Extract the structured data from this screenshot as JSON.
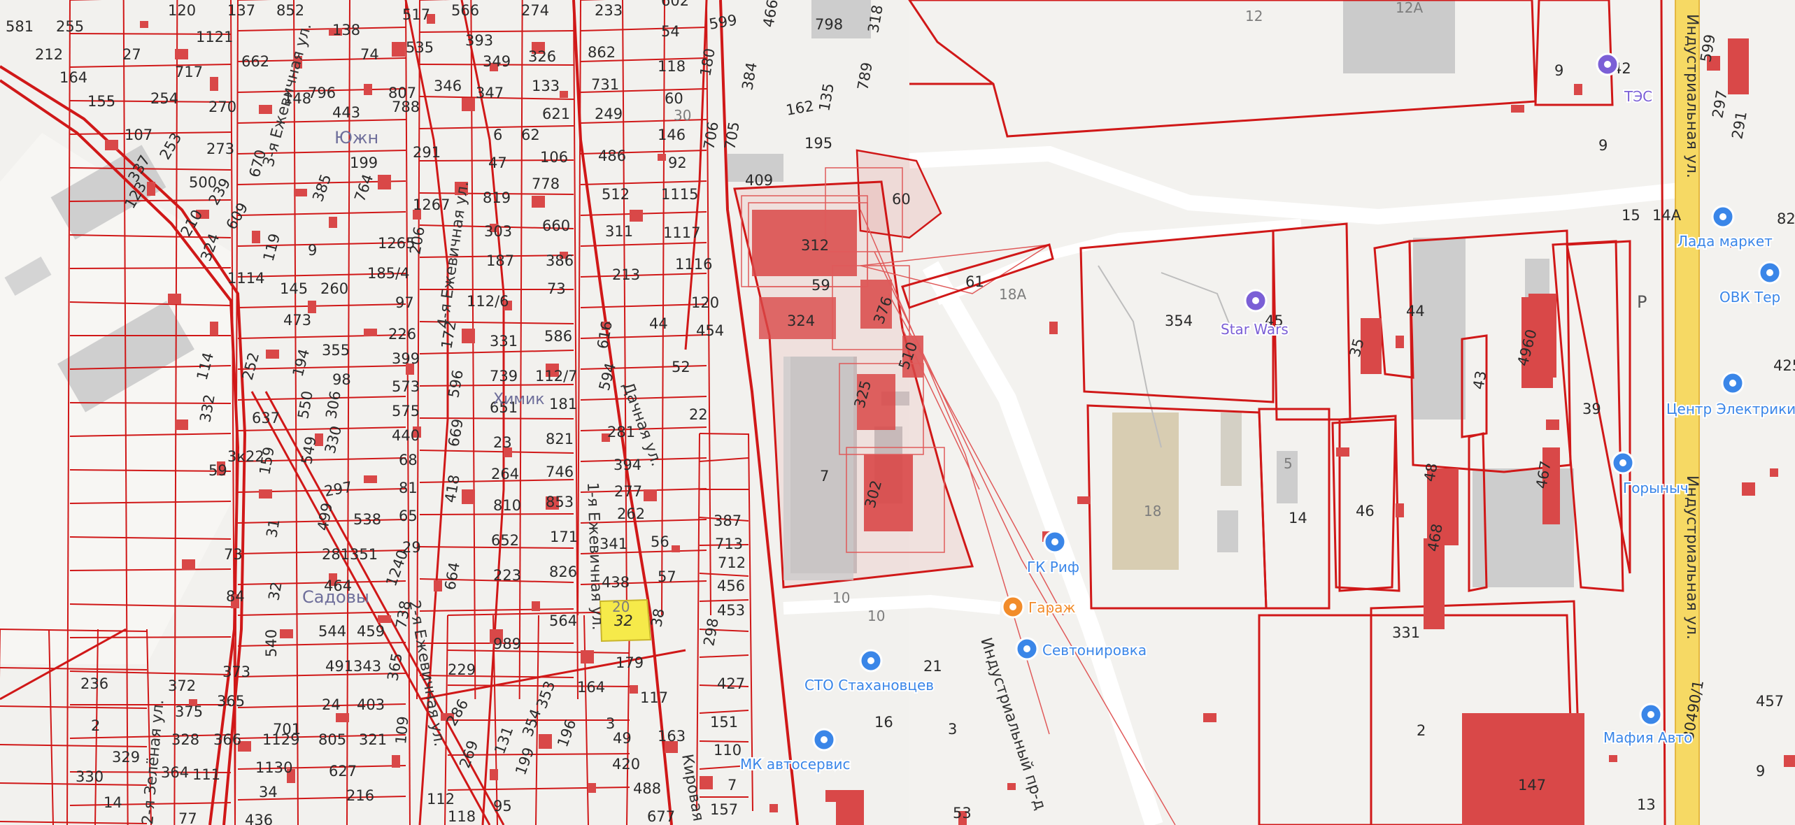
{
  "colors": {
    "background": "#f2f1ee",
    "parcel_line": "#d01818",
    "building_fill": "#d94848",
    "selected_parcel": "#f6ea4a",
    "poi_blue": "#3a86e8",
    "poi_orange": "#f28c2a",
    "poi_purple": "#7b5fd6",
    "highway_yellow": "#f6d964"
  },
  "streets": [
    {
      "id": "industrialnaya-1",
      "text": "Индустриальная ул."
    },
    {
      "id": "industrialnaya-2",
      "text": "Индустриальная ул."
    },
    {
      "id": "industrialny-pr",
      "text": "Индустриальный пр-д"
    },
    {
      "id": "ezhevichnaya-3",
      "text": "3-я Ежевичная ул."
    },
    {
      "id": "ezhevichnaya-4",
      "text": "4-я Ежевичная ул."
    },
    {
      "id": "ezhevichnaya-1",
      "text": "1-я Ежевичная ул."
    },
    {
      "id": "ezhevichnaya-2",
      "text": "2-я Ежевичная ул."
    },
    {
      "id": "dachnaya",
      "text": "Дачная ул."
    },
    {
      "id": "zelenaya",
      "text": "2-я Зелёная ул."
    },
    {
      "id": "kirova",
      "text": "Кировая ул."
    }
  ],
  "areas": [
    {
      "id": "yuzhny",
      "text": "Южн"
    },
    {
      "id": "khimik",
      "text": "Химик"
    },
    {
      "id": "sadovy",
      "text": "Садовы"
    }
  ],
  "pois": [
    {
      "id": "tes",
      "text": "ТЭС",
      "icon": "power-plant-icon",
      "color": "#7b5fd6"
    },
    {
      "id": "star-wars",
      "text": "Star Wars",
      "icon": "trophy-icon",
      "color": "#7b5fd6"
    },
    {
      "id": "lada-market",
      "text": "Лада маркет",
      "icon": "car-icon",
      "color": "#3a86e8"
    },
    {
      "id": "ovk",
      "text": "ОВК Тер",
      "icon": "shopping-bag-icon",
      "color": "#3a86e8"
    },
    {
      "id": "center-electric",
      "text": "Центр Электрики",
      "icon": "shopping-bag-icon",
      "color": "#3a86e8"
    },
    {
      "id": "gorynych",
      "text": "Горыныч",
      "icon": "shopping-bag-icon",
      "color": "#3a86e8"
    },
    {
      "id": "gk-rif",
      "text": "ГК Риф",
      "icon": "car-icon",
      "color": "#3a86e8"
    },
    {
      "id": "garazh",
      "text": "Гараж",
      "icon": "cafe-icon",
      "color": "#f28c2a"
    },
    {
      "id": "sevtonirovka",
      "text": "Севтонировка",
      "icon": "car-icon",
      "color": "#3a86e8"
    },
    {
      "id": "sto-stakhanovtsev",
      "text": "СТО Стахановцев",
      "icon": "car-icon",
      "color": "#3a86e8"
    },
    {
      "id": "mk-avtoservis",
      "text": "МК автосервис",
      "icon": "wrench-icon",
      "color": "#3a86e8"
    },
    {
      "id": "mafia-avto",
      "text": "Мафия Авто",
      "icon": "car-icon",
      "color": "#3a86e8"
    },
    {
      "id": "parking",
      "text": "P",
      "icon": "parking-icon",
      "color": "#555555"
    }
  ],
  "parcels": {
    "n581": "581",
    "n212": "212",
    "n255": "255",
    "n120": "120",
    "n137": "137",
    "n852": "852",
    "n517": "517",
    "n566": "566",
    "n274": "274",
    "n233": "233",
    "n602": "602",
    "n466": "466",
    "n798": "798",
    "n318": "318",
    "n27": "27",
    "n164": "164",
    "n155": "155",
    "n717": "717",
    "n1121": "1121",
    "n662": "662",
    "n138": "138",
    "n74": "74",
    "n535": "535",
    "n393": "393",
    "n349": "349",
    "n326": "326",
    "n862": "862",
    "n54": "54",
    "n599": "599",
    "n107": "107",
    "n254": "254",
    "n270": "270",
    "n443": "443",
    "n788": "788",
    "n807": "807",
    "n346": "346",
    "n347": "347",
    "n133": "133",
    "n731": "731",
    "n118": "118",
    "n180": "180",
    "n384": "384",
    "n162": "162",
    "n135": "135",
    "n789": "789",
    "n148": "148",
    "n796": "796",
    "n273": "273",
    "n199": "199",
    "n291": "291",
    "n6": "6",
    "n62": "62",
    "n621": "621",
    "n249": "249",
    "n60": "60",
    "n30": "30",
    "n146": "146",
    "n706": "706",
    "n705": "705",
    "n195": "195",
    "n337": "337",
    "n253": "253",
    "n500": "500",
    "n670": "670",
    "n385": "385",
    "n47": "47",
    "n106": "106",
    "n486": "486",
    "n92": "92",
    "n409": "409",
    "n123": "123",
    "n239": "239",
    "n764": "764",
    "n1267": "1267",
    "n819": "819",
    "n778": "778",
    "n512": "512",
    "n1115": "1115",
    "n210": "210",
    "n609": "609",
    "n303": "303",
    "n660": "660",
    "n311": "311",
    "n1117": "1117",
    "n324a": "324",
    "n119": "119",
    "n9": "9",
    "n1265": "1265",
    "n206": "206",
    "n187": "187",
    "n386": "386",
    "n213": "213",
    "n1116": "1116",
    "n1114": "1114",
    "n145": "145",
    "n260": "260",
    "n1854": "185/4",
    "n97": "97",
    "n1126": "112/6",
    "n73": "73",
    "n120b": "120",
    "n454": "454",
    "n473": "473",
    "n53": "53",
    "n226": "226",
    "n172": "172",
    "n44": "44",
    "n331": "331",
    "n586": "586",
    "n616": "616",
    "n252": "252",
    "n355": "355",
    "n399": "399",
    "n52": "52",
    "n114": "114",
    "n194": "194",
    "n98": "98",
    "n573": "573",
    "n596": "596",
    "n739": "739",
    "n1127": "112/7",
    "n594": "594",
    "n332": "332",
    "n637": "637",
    "n550": "550",
    "n306": "306",
    "n575": "575",
    "n651": "651",
    "n181": "181",
    "n22": "22",
    "n440": "440",
    "n669": "669",
    "n23": "23",
    "n821": "821",
    "n281": "281",
    "n330": "330",
    "n68": "68",
    "n59": "59",
    "n159": "159",
    "n549": "549",
    "n81": "81",
    "n418": "418",
    "n264": "264",
    "n746": "746",
    "n394": "394",
    "n277": "277",
    "n3k22": "3к22",
    "n297": "297",
    "n810": "810",
    "n853": "853",
    "n262": "262",
    "n387": "387",
    "n73b": "73",
    "n31": "31",
    "n499": "499",
    "n538": "538",
    "n65": "65",
    "n652": "652",
    "n171": "171",
    "n713": "713",
    "n281b": "281",
    "n351": "351",
    "n29": "29",
    "n341": "341",
    "n56": "56",
    "n712": "712",
    "n84": "84",
    "n32": "32",
    "n464": "464",
    "n1240": "1240",
    "n664": "664",
    "n223": "223",
    "n826": "826",
    "n438": "438",
    "n57": "57",
    "n456": "456",
    "n32sel": "32",
    "n20": "20",
    "n38": "38",
    "n453": "453",
    "n544": "544",
    "n459": "459",
    "n738": "738",
    "n564": "564",
    "n989": "989",
    "n298": "298",
    "n236": "236",
    "n372": "372",
    "n540": "540",
    "n373": "373",
    "n491": "491",
    "n343": "343",
    "n229": "229",
    "n179": "179",
    "n427": "427",
    "n2": "2",
    "n375": "375",
    "n365": "365",
    "n24": "24",
    "n403": "403",
    "n365b": "365",
    "n353": "353",
    "n164b": "164",
    "n117": "117",
    "n286": "286",
    "n354": "354",
    "n151": "151",
    "n329": "329",
    "n328": "328",
    "n366": "366",
    "n701": "701",
    "n805": "805",
    "n321": "321",
    "n109": "109",
    "n3": "3",
    "n49": "49",
    "n163": "163",
    "n131": "131",
    "n196": "196",
    "n110": "110",
    "n330b": "330",
    "n364": "364",
    "n111": "111",
    "n1129": "1129",
    "n627": "627",
    "n269": "269",
    "n199b": "199",
    "n420": "420",
    "n1130": "1130",
    "n488": "488",
    "n7": "7",
    "n14": "14",
    "n34": "34",
    "n216": "216",
    "n436": "436",
    "n112": "112",
    "n118b": "118",
    "n95": "95",
    "n677": "677",
    "n157": "157",
    "n77": "77",
    "n312": "312",
    "n60b": "60",
    "n59b": "59",
    "n324": "324",
    "n376": "376",
    "n61": "61",
    "n510": "510",
    "n325": "325",
    "n302": "302",
    "n7b": "7",
    "n18A": "18А",
    "n354b": "354",
    "n45": "45",
    "n44b": "44",
    "n35": "35",
    "n4960": "4960",
    "n43": "43",
    "n39": "39",
    "n18": "18",
    "n5": "5",
    "n14b": "14",
    "n46": "46",
    "n48": "48",
    "n468": "468",
    "n467": "467",
    "n10": "10",
    "n10b": "10",
    "n21": "21",
    "n16": "16",
    "n3b": "3",
    "n331b": "331",
    "n2b": "2",
    "n147": "147",
    "n13": "13",
    "n12": "12",
    "n12A": "12А",
    "n9b": "9",
    "n42": "42",
    "n9c": "9",
    "n14A": "14А",
    "n15": "15",
    "n82": "82",
    "n425": "425",
    "n457": "457",
    "n30490": "30490/1",
    "n599b": "599",
    "n297b": "297",
    "n291b": "291",
    "n9d": "9"
  }
}
